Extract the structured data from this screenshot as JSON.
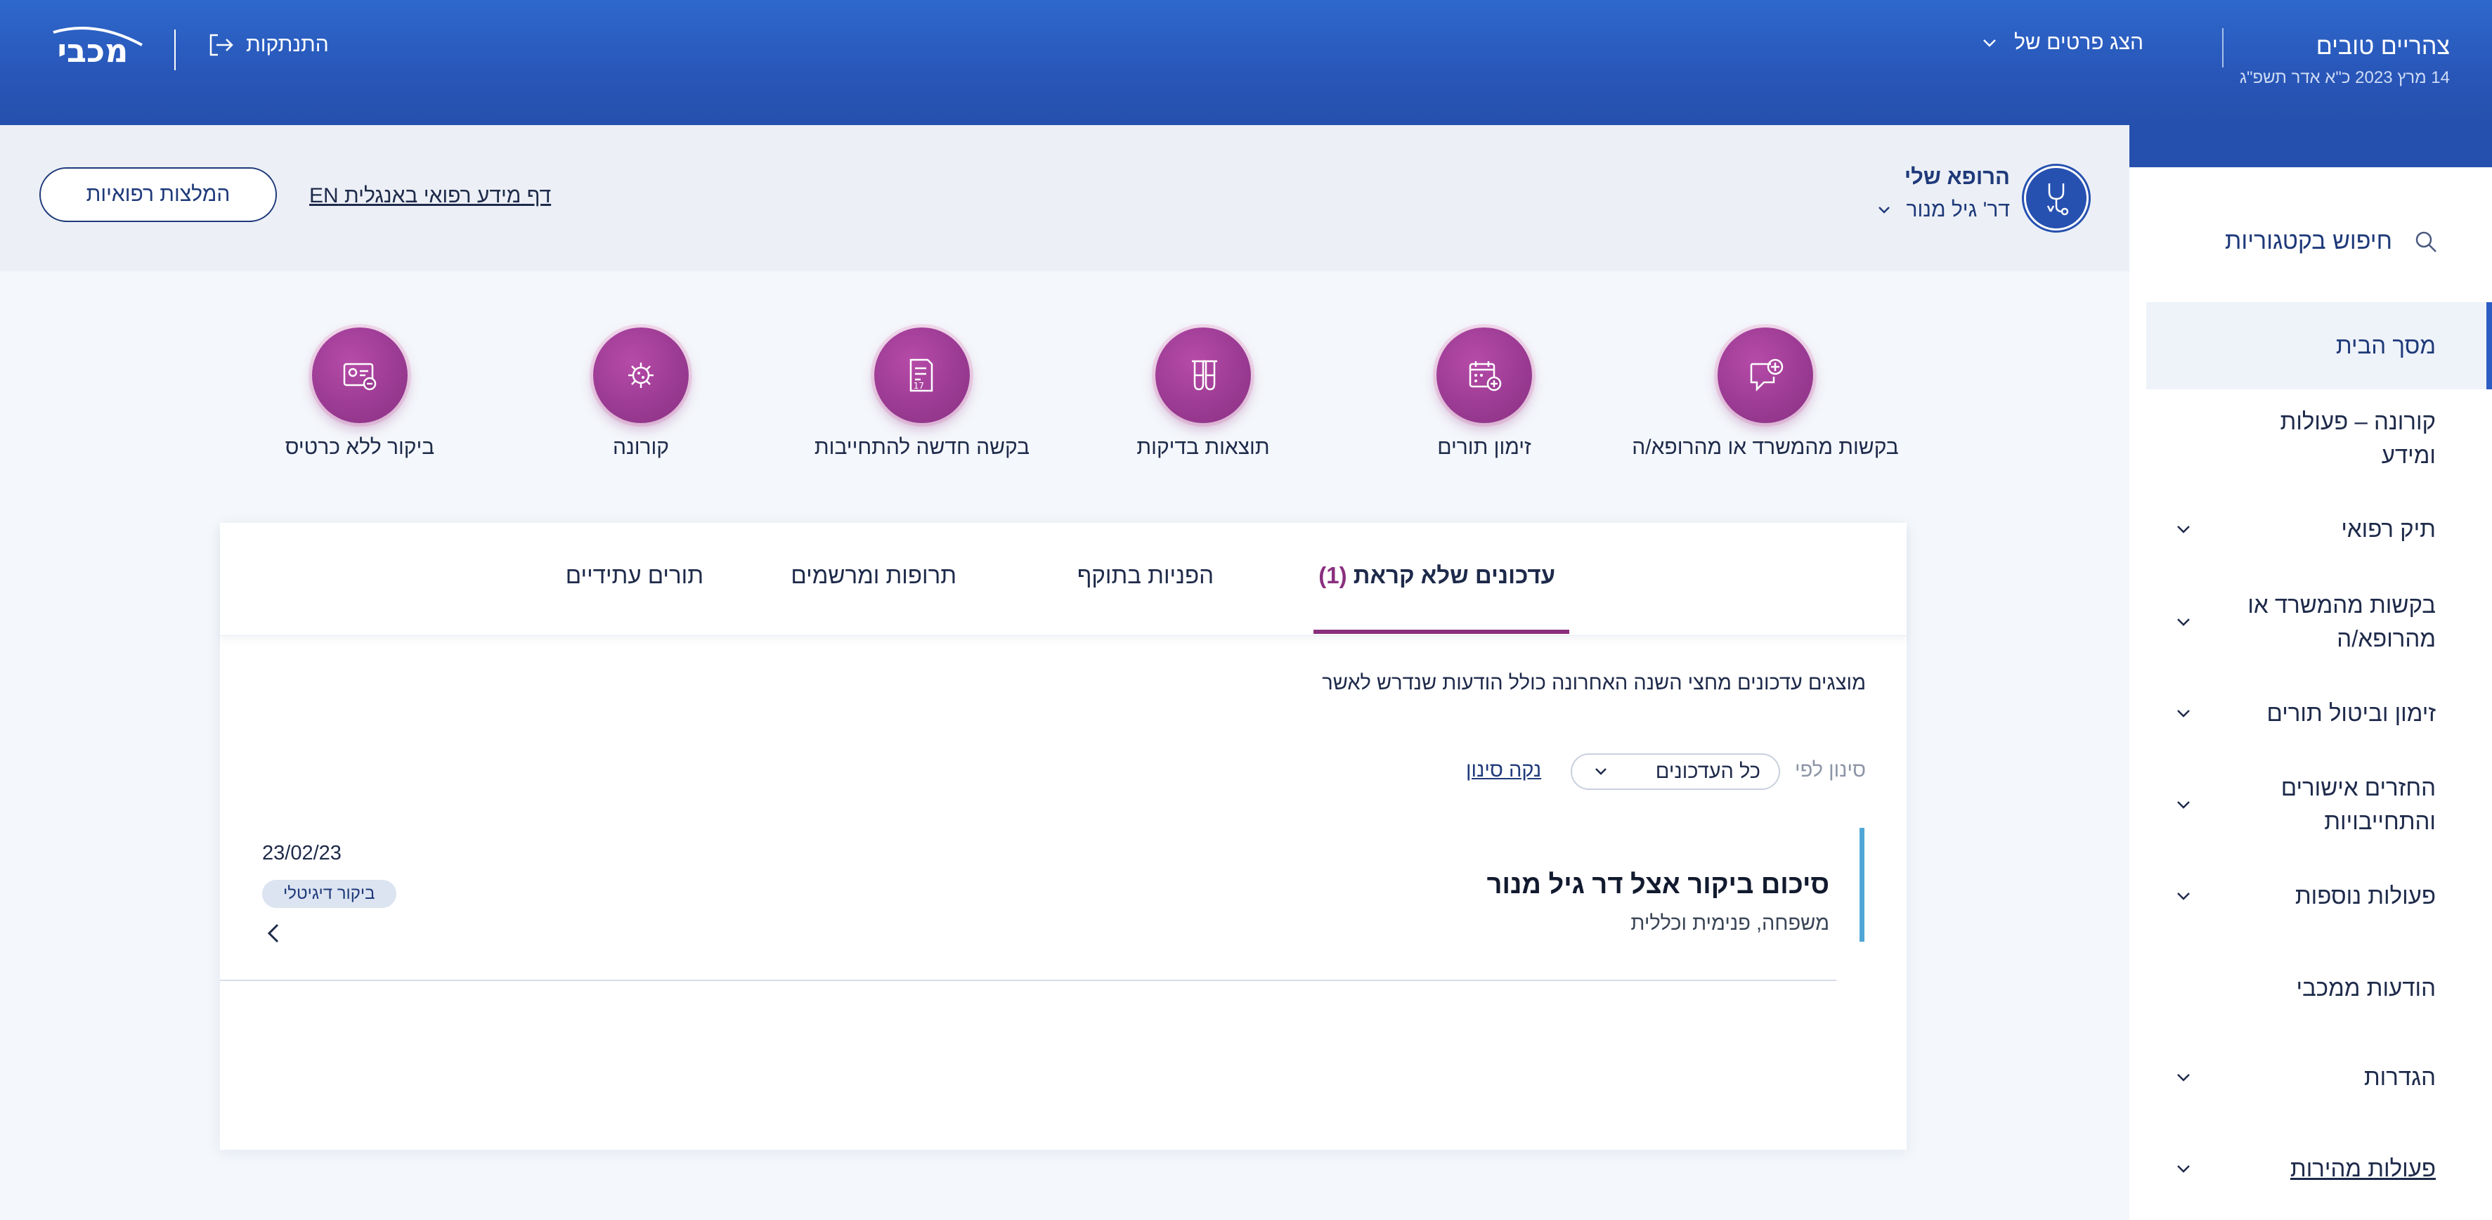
{
  "header": {
    "greeting": "צהריים טובים",
    "date": "14 מרץ 2023 כ\"א אדר תשפ\"ג",
    "show_details": "הצג פרטים של",
    "logout": "התנתקות",
    "logo_text": "מכבי"
  },
  "sidebar": {
    "search": "חיפוש בקטגוריות",
    "items": [
      {
        "label": "מסך הבית"
      },
      {
        "label": "קורונה – פעולות ומידע"
      },
      {
        "label": "תיק רפואי"
      },
      {
        "label": "בקשות מהמשרד או מהרופא/ה"
      },
      {
        "label": "זימון וביטול תורים"
      },
      {
        "label": "החזרים אישורים והתחייבויות"
      },
      {
        "label": "פעולות נוספות"
      },
      {
        "label": "הודעות ממכבי"
      },
      {
        "label": "הגדרות"
      },
      {
        "label": "פעולות מהירות"
      }
    ]
  },
  "doctor": {
    "title": "הרופא שלי",
    "name": "דר' גיל מנור",
    "en_link": "דף מידע רפואי באנגלית EN",
    "recommendations_button": "המלצות רפואיות"
  },
  "quick_actions": [
    {
      "label": "בקשות מהמשרד או מהרופא/ה",
      "icon": "chat-plus-icon"
    },
    {
      "label": "זימון תורים",
      "icon": "calendar-plus-icon"
    },
    {
      "label": "תוצאות בדיקות",
      "icon": "test-tubes-icon"
    },
    {
      "label": "בקשה חדשה להתחייבות",
      "icon": "document-form-icon"
    },
    {
      "label": "קורונה",
      "icon": "virus-icon"
    },
    {
      "label": "ביקור ללא כרטיס",
      "icon": "card-minus-icon"
    }
  ],
  "tabs": [
    {
      "label": "עדכונים שלא קראת",
      "count": "(1)"
    },
    {
      "label": "הפניות בתוקף"
    },
    {
      "label": "תרופות ומרשמים"
    },
    {
      "label": "תורים עתידיים"
    }
  ],
  "updates": {
    "info": "מוצגים עדכונים מחצי השנה האחרונה כולל הודעות שנדרש לאשר",
    "filter_label": "סינון לפי",
    "filter_value": "כל העדכונים",
    "clear_filter": "נקה סינון",
    "items": [
      {
        "title": "סיכום ביקור אצל דר גיל מנור",
        "subtitle": "משפחה, פנימית וכללית",
        "date": "23/02/23",
        "badge": "ביקור דיגיטלי"
      }
    ]
  },
  "colors": {
    "header_blue": "#2f68cc",
    "accent_purple": "#8a2f7e",
    "navy": "#1f3a7a",
    "update_bar": "#4fa6d6"
  }
}
